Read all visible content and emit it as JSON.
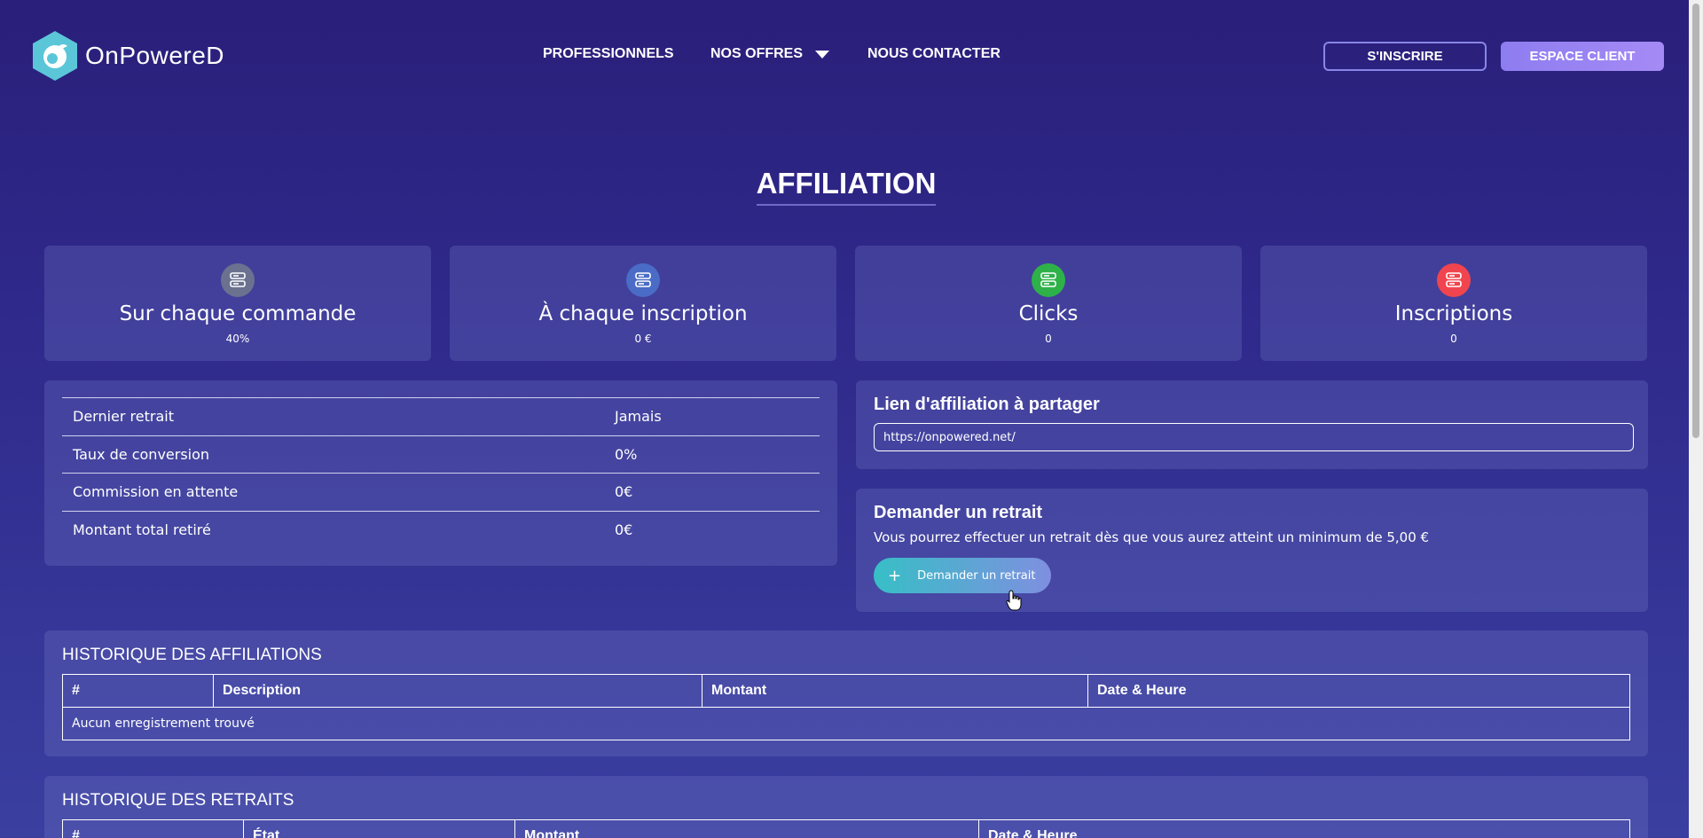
{
  "brand": {
    "name": "OnPowereD",
    "accent": "#5bc6d8"
  },
  "nav": {
    "items": [
      {
        "label": "PROFESSIONNELS"
      },
      {
        "label": "NOS OFFRES"
      },
      {
        "label": "NOUS CONTACTER"
      }
    ]
  },
  "header": {
    "signup_label": "S'INSCRIRE",
    "client_label": "ESPACE CLIENT"
  },
  "page": {
    "title": "AFFILIATION"
  },
  "stats": [
    {
      "title": "Sur chaque commande",
      "value": "40%",
      "icon": "server-icon",
      "color": "#6a7290"
    },
    {
      "title": "À chaque inscription",
      "value": "0 €",
      "icon": "server-icon",
      "color": "#4a6bc6"
    },
    {
      "title": "Clicks",
      "value": "0",
      "icon": "server-icon",
      "color": "#2fb14a"
    },
    {
      "title": "Inscriptions",
      "value": "0",
      "icon": "server-icon",
      "color": "#f0454e"
    }
  ],
  "info": {
    "rows": [
      {
        "label": "Dernier retrait",
        "value": "Jamais"
      },
      {
        "label": "Taux de conversion",
        "value": "0%"
      },
      {
        "label": "Commission en attente",
        "value": "0€"
      },
      {
        "label": "Montant total retiré",
        "value": "0€"
      }
    ]
  },
  "affiliate_link": {
    "heading": "Lien d'affiliation à partager",
    "value": "https://onpowered.net/"
  },
  "withdraw": {
    "heading": "Demander un retrait",
    "description": "Vous pourrez effectuer un retrait dès que vous aurez atteint un minimum de 5,00 €",
    "button_label": "Demander un retrait",
    "button_icon": "plus-icon"
  },
  "affiliation_history": {
    "heading": "HISTORIQUE DES AFFILIATIONS",
    "columns": [
      "#",
      "Description",
      "Montant",
      "Date & Heure"
    ],
    "empty_text": "Aucun enregistrement trouvé"
  },
  "withdraw_history": {
    "heading": "HISTORIQUE DES RETRAITS",
    "columns": [
      "#",
      "État",
      "Montant",
      "Date & Heure"
    ]
  }
}
